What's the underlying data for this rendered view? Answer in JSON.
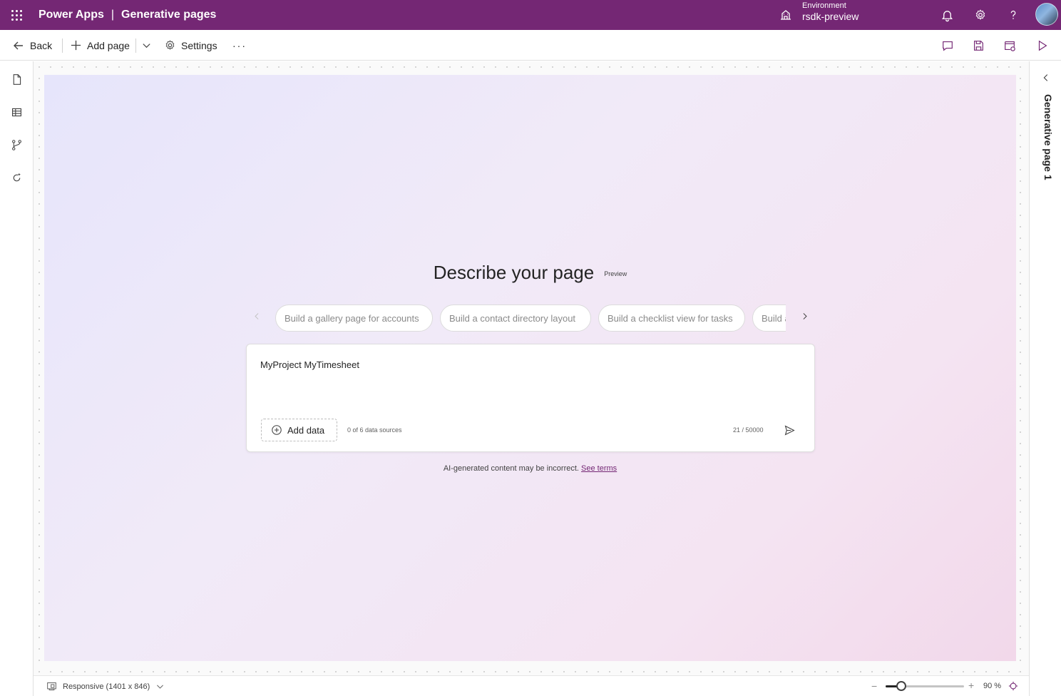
{
  "header": {
    "app_name": "Power Apps",
    "separator": "|",
    "page_title": "Generative pages",
    "environment_label": "Environment",
    "environment_name": "rsdk-preview"
  },
  "toolbar": {
    "back_label": "Back",
    "add_page_label": "Add page",
    "settings_label": "Settings",
    "more_label": "···"
  },
  "canvas": {
    "title": "Describe your page",
    "badge": "Preview",
    "suggestions": [
      "Build a gallery page for accounts",
      "Build a contact directory layout",
      "Build a checklist view for tasks",
      "Build a"
    ],
    "prompt_value": "MyProject MyTimesheet",
    "add_data_label": "Add data",
    "data_sources": "0 of 6 data sources",
    "char_count": "21 / 50000",
    "disclaimer": "AI-generated content may be incorrect.",
    "terms_link": "See terms"
  },
  "right_panel": {
    "title": "Generative page 1"
  },
  "bottom_bar": {
    "responsive_label": "Responsive (1401 x 846)",
    "zoom_minus": "−",
    "zoom_plus": "+",
    "zoom_label": "90 %",
    "zoom_fraction": 0.2
  },
  "icons": {
    "waffle": "app-launcher-icon",
    "environment": "environment-icon",
    "bell": "notification-icon",
    "gear": "settings-icon",
    "help": "help-icon"
  },
  "colors": {
    "brand": "#742774",
    "link": "#742774"
  }
}
